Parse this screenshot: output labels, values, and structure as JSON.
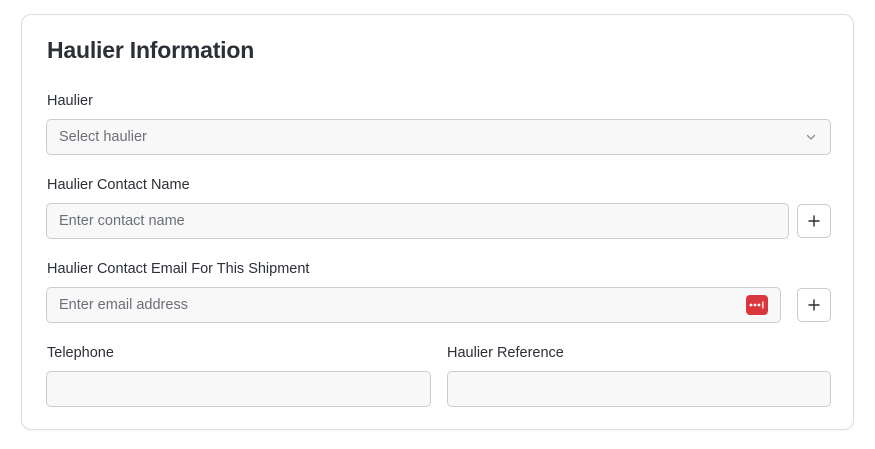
{
  "section": {
    "title": "Haulier Information"
  },
  "haulier": {
    "label": "Haulier",
    "placeholder": "Select haulier"
  },
  "contact_name": {
    "label": "Haulier Contact Name",
    "placeholder": "Enter contact name"
  },
  "contact_email": {
    "label": "Haulier Contact Email For This Shipment",
    "placeholder": "Enter email address"
  },
  "telephone": {
    "label": "Telephone",
    "value": ""
  },
  "haulier_reference": {
    "label": "Haulier Reference",
    "value": ""
  },
  "icons": {
    "select_chevron": "chevron-down-icon",
    "add": "plus-icon",
    "password_manager": "password-manager-icon"
  },
  "colors": {
    "field_bg": "#f8f8f9",
    "field_border": "#c9ccd1",
    "password_manager_icon": "#d9363e"
  }
}
